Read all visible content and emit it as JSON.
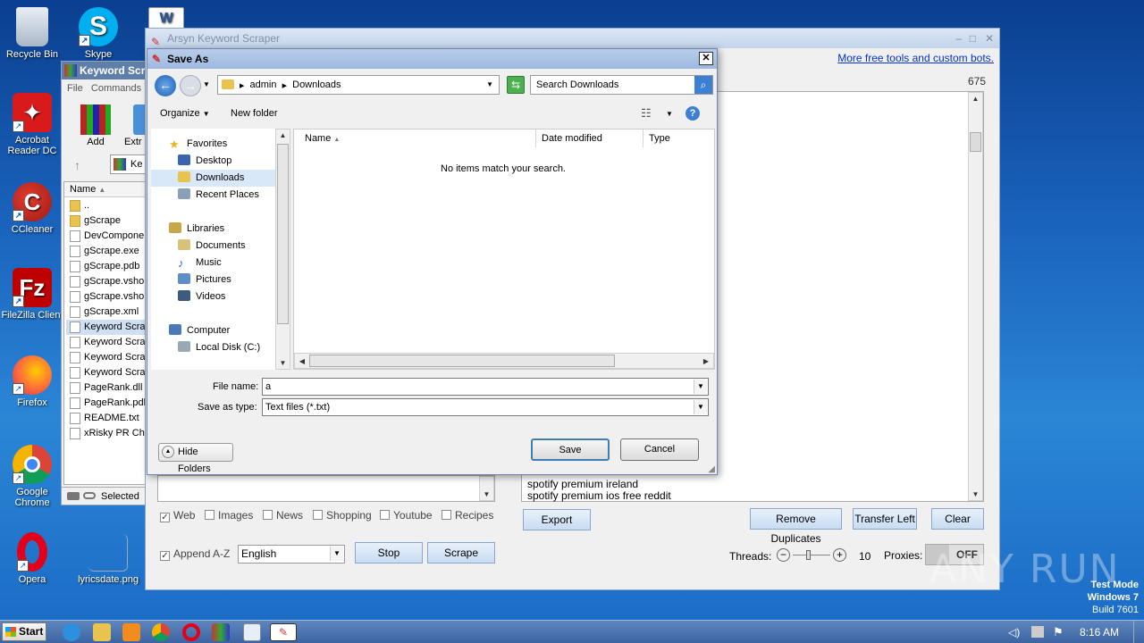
{
  "desktop": {
    "icons": [
      {
        "name": "recycle-bin",
        "label": "Recycle Bin"
      },
      {
        "name": "skype",
        "label": "Skype"
      },
      {
        "name": "acrobat",
        "label": "Acrobat Reader DC"
      },
      {
        "name": "ccleaner",
        "label": "CCleaner"
      },
      {
        "name": "filezilla",
        "label": "FileZilla Client"
      },
      {
        "name": "firefox",
        "label": "Firefox"
      },
      {
        "name": "chrome",
        "label": "Google Chrome"
      },
      {
        "name": "opera",
        "label": "Opera"
      },
      {
        "name": "lyrics",
        "label": "lyricsdate.png"
      },
      {
        "name": "word",
        "label": ""
      }
    ]
  },
  "winrar": {
    "title": "Keyword Scr",
    "menu": [
      "File",
      "Commands"
    ],
    "tools": [
      "Add",
      "Extr"
    ],
    "path": "Ke",
    "col_name": "Name",
    "files": [
      "..",
      "gScrape",
      "DevComponer",
      "gScrape.exe",
      "gScrape.pdb",
      "gScrape.vsho",
      "gScrape.vsho",
      "gScrape.xml",
      "Keyword Scra",
      "Keyword Scra",
      "Keyword Scra",
      "Keyword Scra",
      "PageRank.dll",
      "PageRank.pdb",
      "README.txt",
      "xRisky PR Che"
    ],
    "status": "Selected"
  },
  "app": {
    "title": "Arsyn Keyword Scraper",
    "link": "More free tools and custom bots.",
    "count": "675",
    "results": [
      "spotify premium ireland",
      "spotify premium ios free reddit"
    ],
    "sources": [
      {
        "label": "Web",
        "checked": true
      },
      {
        "label": "Images",
        "checked": false
      },
      {
        "label": "News",
        "checked": false
      },
      {
        "label": "Shopping",
        "checked": false
      },
      {
        "label": "Youtube",
        "checked": false
      },
      {
        "label": "Recipes",
        "checked": false
      }
    ],
    "export_label": "Export",
    "remove_dup_label": "Remove Duplicates",
    "transfer_left_label": "Transfer Left",
    "clear_label": "Clear",
    "append_label": "Append A-Z",
    "append_checked": true,
    "language": "English",
    "stop_label": "Stop",
    "scrape_label": "Scrape",
    "threads_label": "Threads:",
    "threads_value": "10",
    "threads_fraction": 0.35,
    "proxies_label": "Proxies:",
    "proxies_state": "OFF"
  },
  "dialog": {
    "title": "Save As",
    "breadcrumb": [
      "admin",
      "Downloads"
    ],
    "search_placeholder": "Search Downloads",
    "organize_label": "Organize",
    "new_folder_label": "New folder",
    "nav": {
      "favorites": "Favorites",
      "favorites_items": [
        "Desktop",
        "Downloads",
        "Recent Places"
      ],
      "libraries": "Libraries",
      "libraries_items": [
        "Documents",
        "Music",
        "Pictures",
        "Videos"
      ],
      "computer": "Computer",
      "computer_items": [
        "Local Disk (C:)"
      ]
    },
    "columns": [
      "Name",
      "Date modified",
      "Type"
    ],
    "empty_message": "No items match your search.",
    "file_name_label": "File name:",
    "file_name_value": "a",
    "save_type_label": "Save as type:",
    "save_type_value": "Text files (*.txt)",
    "save_label": "Save",
    "cancel_label": "Cancel",
    "hide_folders_label": "Hide Folders"
  },
  "taskbar": {
    "start_label": "Start",
    "clock": "8:16 AM"
  },
  "watermark": {
    "text": "ANY RUN",
    "mode": "Test Mode",
    "os": "Windows 7",
    "build": "Build 7601"
  }
}
